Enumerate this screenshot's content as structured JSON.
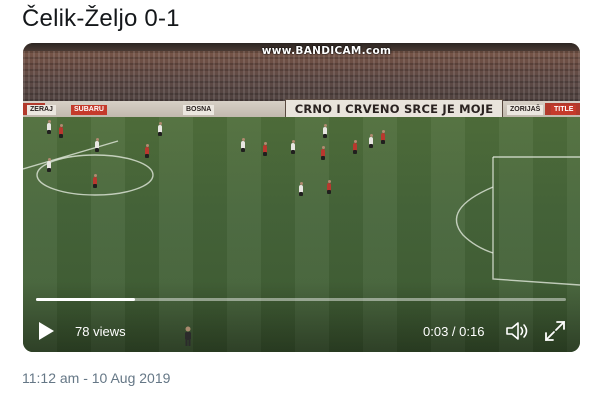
{
  "tweet": {
    "text": "Čelik-Željo 0-1",
    "timestamp": "11:12 am - 10 Aug 2019"
  },
  "video": {
    "watermark": "www.BANDICAM.com",
    "banner_text": "CRNO I CRVENO SRCE JE MOJE",
    "ad_boards": [
      "ZERAJ",
      "SUBARU",
      "BOSNA",
      "ZORIJAŠ",
      "TITLE"
    ],
    "views_label": "78 views",
    "time_label": "0:03 / 0:16",
    "progress_fraction": 0.1875,
    "icons": {
      "play": "play-icon",
      "volume": "volume-icon",
      "fullscreen": "fullscreen-icon"
    },
    "colors": {
      "pitch": "#46653a",
      "home_kit": "#e8e6e2",
      "away_kit": "#b8382e"
    }
  }
}
